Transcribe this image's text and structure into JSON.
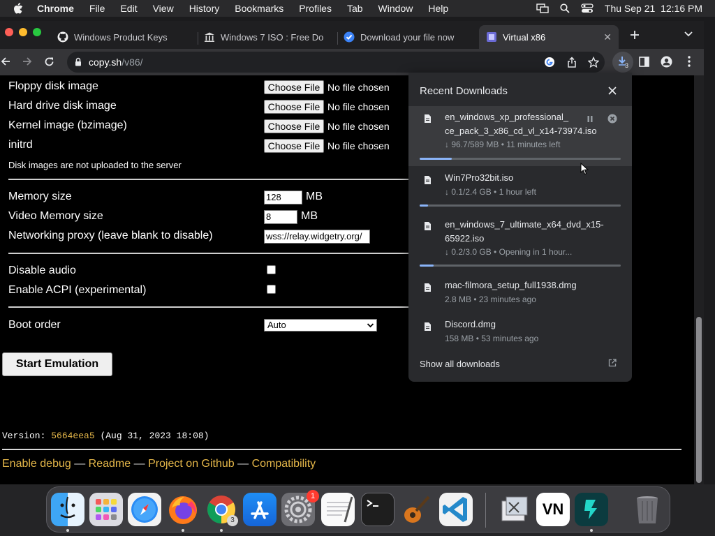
{
  "menubar": {
    "app_name": "Chrome",
    "menus": [
      "File",
      "Edit",
      "View",
      "History",
      "Bookmarks",
      "Profiles",
      "Tab",
      "Window",
      "Help"
    ],
    "clock": "Thu Sep 21  12:16 PM"
  },
  "tabs": [
    {
      "title": "Windows Product Keys",
      "icon": "github-icon"
    },
    {
      "title": "Windows 7 ISO : Free Do",
      "icon": "archive-icon"
    },
    {
      "title": "Download your file now",
      "icon": "check-badge-icon"
    },
    {
      "title": "Virtual x86",
      "icon": "v86-icon",
      "active": true
    }
  ],
  "address_bar": {
    "host": "copy.sh",
    "path": "/v86/"
  },
  "downloads_badge": "3",
  "form": {
    "file_rows": [
      {
        "label": "Floppy disk image",
        "button": "Choose File",
        "status": "No file chosen"
      },
      {
        "label": "Hard drive disk image",
        "button": "Choose File",
        "status": "No file chosen"
      },
      {
        "label": "Kernel image (bzimage)",
        "button": "Choose File",
        "status": "No file chosen"
      },
      {
        "label": "initrd",
        "button": "Choose File",
        "status": "No file chosen"
      }
    ],
    "disk_note": "Disk images are not uploaded to the server",
    "memory_label": "Memory size",
    "memory_value": "128",
    "memory_unit": "MB",
    "video_label": "Video Memory size",
    "video_value": "8",
    "video_unit": "MB",
    "proxy_label": "Networking proxy (leave blank to disable)",
    "proxy_value": "wss://relay.widgetry.org/",
    "audio_label": "Disable audio",
    "acpi_label": "Enable ACPI (experimental)",
    "boot_label": "Boot order",
    "boot_value": "Auto",
    "start_button": "Start Emulation"
  },
  "version": {
    "label": "Version: ",
    "hash": "5664eea5",
    "date": " (Aug 31, 2023 18:08)"
  },
  "footer_links": [
    "Enable debug",
    "Readme",
    "Project on Github",
    "Compatibility"
  ],
  "footer_separator": "—",
  "downloads": {
    "title": "Recent Downloads",
    "items": [
      {
        "name": "en_windows_xp_professional_ce_pack_3_x86_cd_vl_x14-73974.iso",
        "name_line1": "en_windows_xp_professional_",
        "name_line2": "ce_pack_3_x86_cd_vl_x14-73974.iso",
        "status": "↓ 96.7/589 MB • 11 minutes left",
        "progress": 0.16,
        "paused_control": true
      },
      {
        "name": "Win7Pro32bit.iso",
        "status": "↓ 0.1/2.4 GB • 1 hour left",
        "progress": 0.04
      },
      {
        "name_line1": "en_windows_7_ultimate_x64_dvd_x15-",
        "name_line2": "65922.iso",
        "status": "↓ 0.2/3.0 GB • Opening in 1 hour...",
        "progress": 0.07
      },
      {
        "name": "mac-filmora_setup_full1938.dmg",
        "status": "2.8 MB • 23 minutes ago"
      },
      {
        "name": "Discord.dmg",
        "status": "158 MB • 53 minutes ago"
      }
    ],
    "show_all": "Show all downloads"
  },
  "dock": {
    "apps": [
      "Finder",
      "Launchpad",
      "Safari",
      "Firefox",
      "Chrome",
      "App Store",
      "System Settings",
      "TextEdit",
      "Terminal",
      "GarageBand",
      "Visual Studio Code",
      "Preview",
      "VN",
      "Filmora",
      "Trash"
    ],
    "badges": {
      "chrome": "3",
      "settings": "1"
    },
    "vn_label": "VN"
  },
  "colors": {
    "accent": "#8ab4f8",
    "link_gold": "#e6b84a",
    "page_bg": "#000000",
    "panel_bg": "#292a2d"
  }
}
